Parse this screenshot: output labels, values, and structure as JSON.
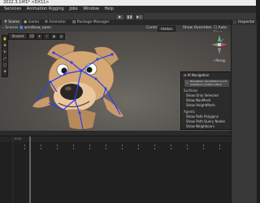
{
  "titlebar": {
    "text": "2022.3.14f1* <DX11>"
  },
  "menu": [
    "Services",
    "Animation Rigging",
    "Jobs",
    "Window",
    "Help"
  ],
  "tabs": [
    "Scene",
    "Game",
    "Animator",
    "Package Manager"
  ],
  "scene_toolbar": {
    "scenes_label": "Scenes",
    "scene_name": "windbow_open",
    "control_label": "Control",
    "hidden_value": "Hidden",
    "show_overrides": "Show Overrides",
    "auto_save": "Auto Save"
  },
  "shading": {
    "mode": "Shaded",
    "dim": "2D"
  },
  "persp_label": "Persp",
  "nav_panel": {
    "title": "AI Navigation",
    "info": "Navigation visualization is not available in prefab edition.",
    "surfaces_header": "Surfaces",
    "surfaces": [
      "Show Only Selected",
      "Show NavMesh",
      "Show HeightMesh"
    ],
    "agents_header": "Agents",
    "agents": [
      "Show Path Polygons",
      "Show Path Query Nodes",
      "Show Neighbours"
    ]
  },
  "inspector_title": "Inspector",
  "timeline": {
    "frame_marker": "0:00"
  },
  "colors": {
    "bones": "#2b3ff0",
    "accent": "#3a79d8",
    "playhead": "#d23c3c"
  }
}
